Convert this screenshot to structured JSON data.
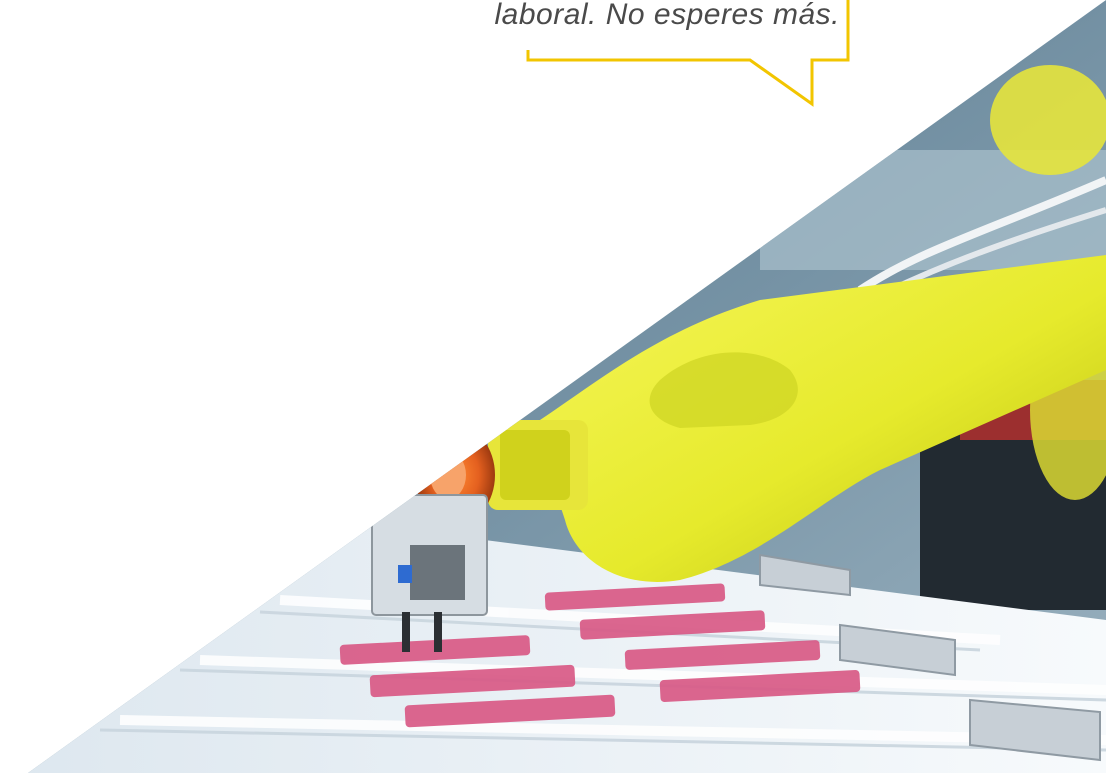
{
  "callout": {
    "text": "laboral. No esperes más."
  },
  "photo": {
    "subject": "yellow-robotic-arm-picking-parts",
    "colors": {
      "accent": "#f2c500",
      "robot_yellow": "#e8ec2a",
      "tray_white": "#eef3f7",
      "part_pink": "#d95a86",
      "background_blue": "#6f8da0"
    }
  }
}
